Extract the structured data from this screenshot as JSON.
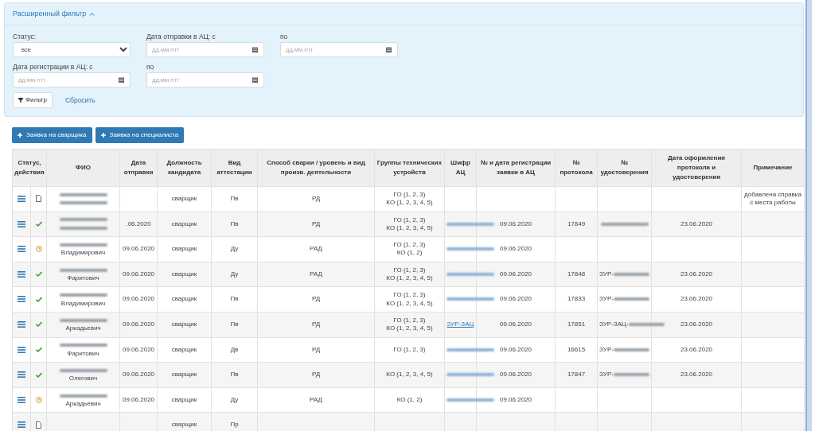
{
  "filter": {
    "title": "Расширенный фильтр",
    "expanded": true,
    "field_rows": [
      [
        {
          "kind": "select",
          "label": "Статус:",
          "value": "все"
        },
        {
          "kind": "date",
          "label": "Дата отправки в АЦ: с",
          "placeholder": "дд.мм.гггг"
        },
        {
          "kind": "date",
          "label": "по",
          "placeholder": "дд.мм.гггг"
        }
      ],
      [
        {
          "kind": "date",
          "label": "Дата регистрации в АЦ: с",
          "placeholder": "дд.мм.гггг"
        },
        {
          "kind": "date",
          "label": "по",
          "placeholder": "дд.мм.гггг"
        }
      ]
    ],
    "apply_button": "Фильтр",
    "reset_link": "Сбросить"
  },
  "actions": [
    "Заявка на сварщика",
    "Заявка на специалиста"
  ],
  "table": {
    "columns": [
      "Статус, действия",
      "ФИО",
      "Дата отправки",
      "Должность кандидата",
      "Вид аттестации",
      "Способ сварки / уровень и вид произв. деятельности",
      "Группы технических устройств",
      "Шифр АЦ",
      "№ и дата регистрации заявки в АЦ",
      "№ протокола",
      "№ удостоверения",
      "Дата оформления протокола и удостоверения",
      "Примечание"
    ],
    "rows": [
      {
        "kind": "draft",
        "fio": {
          "blurred": true
        },
        "position": "сварщик",
        "type": "Пв",
        "method": "РД",
        "groups": [
          "ГО (1, 2, 3)",
          "КО (1, 2, 3, 4, 5)"
        ],
        "note": "добавлена справка с места работы"
      },
      {
        "kind": "done",
        "fio": {
          "blurred": true
        },
        "sent": ".06.2020",
        "position": "сварщик",
        "type": "Пв",
        "method": "РД",
        "groups": [
          "ГО (1, 2, 3)",
          "КО (1, 2, 3, 4, 5)"
        ],
        "code": {
          "blurred": true
        },
        "reg": "09.06.2020",
        "protocol": "17849",
        "cert": {
          "blurred": true
        },
        "issued": "23.06.2020"
      },
      {
        "kind": "pending",
        "fio": {
          "text": "Владимирович",
          "blurred": true
        },
        "sent": "09.06.2020",
        "position": "сварщик",
        "type": "Ду",
        "method": "РАД",
        "groups": [
          "ГО (1, 2, 3)",
          "КО (1, 2)"
        ],
        "code": {
          "blurred": true
        },
        "reg": "09.06.2020"
      },
      {
        "kind": "done",
        "fio": {
          "text": "Фаритович",
          "blurred": true
        },
        "sent": "09.06.2020",
        "position": "сварщик",
        "type": "Ду",
        "method": "РАД",
        "groups": [
          "ГО (1, 2, 3)",
          "КО (1, 2, 3, 4, 5)"
        ],
        "code": {
          "blurred": true
        },
        "reg": "09.06.2020",
        "protocol": "17848",
        "cert": {
          "text": "ЗУР-",
          "blurred": true
        },
        "issued": "23.06.2020"
      },
      {
        "kind": "done",
        "fio": {
          "text": "Владимирович",
          "blurred": true
        },
        "sent": "09.06.2020",
        "position": "сварщик",
        "type": "Пв",
        "method": "РД",
        "groups": [
          "ГО (1, 2, 3)",
          "КО (1, 2, 3, 4, 5)"
        ],
        "code": {
          "blurred": true
        },
        "reg": "09.06.2020",
        "protocol": "17833",
        "cert": {
          "text": "ЗУР-",
          "blurred": true
        },
        "issued": "23.06.2020"
      },
      {
        "kind": "done",
        "fio": {
          "text": "Аркадьевич",
          "blurred": true
        },
        "sent": "09.06.2020",
        "position": "сварщик",
        "type": "Пв",
        "method": "РД",
        "groups": [
          "ГО (1, 2, 3)",
          "КО (1, 2, 3, 4, 5)"
        ],
        "code": {
          "text": "ЗУР-ЗАЦ"
        },
        "reg": "09.06.2020",
        "protocol": "17851",
        "cert": {
          "text": "ЗУР-ЗАЦ-",
          "blurred": true
        },
        "issued": "23.06.2020"
      },
      {
        "kind": "done",
        "fio": {
          "text": "Фаритович",
          "blurred": true
        },
        "sent": "09.06.2020",
        "position": "сварщик",
        "type": "Дв",
        "method": "РД",
        "groups": [
          "ГО (1, 2, 3)"
        ],
        "code": {
          "blurred": true
        },
        "reg": "09.06.2020",
        "protocol": "16615",
        "cert": {
          "text": "ЗУР-",
          "blurred": true
        },
        "issued": "23.06.2020"
      },
      {
        "kind": "done",
        "fio": {
          "text": "Олегович",
          "blurred": true
        },
        "sent": "09.06.2020",
        "position": "сварщик",
        "type": "Пв",
        "method": "РД",
        "groups": [
          "КО (1, 2, 3, 4, 5)"
        ],
        "code": {
          "blurred": true
        },
        "reg": "09.06.2020",
        "protocol": "17847",
        "cert": {
          "text": "ЗУР-",
          "blurred": true
        },
        "issued": "23.06.2020"
      },
      {
        "kind": "pending",
        "fio": {
          "text": "Аркадьевич",
          "blurred": true
        },
        "sent": "09.06.2020",
        "position": "сварщик",
        "type": "Ду",
        "method": "РАД",
        "groups": [
          "КО (1, 2)"
        ],
        "code": {
          "blurred": true
        },
        "reg": "09.06.2020"
      },
      {
        "kind": "draft",
        "position": "сварщик",
        "type": "Пр"
      }
    ]
  }
}
